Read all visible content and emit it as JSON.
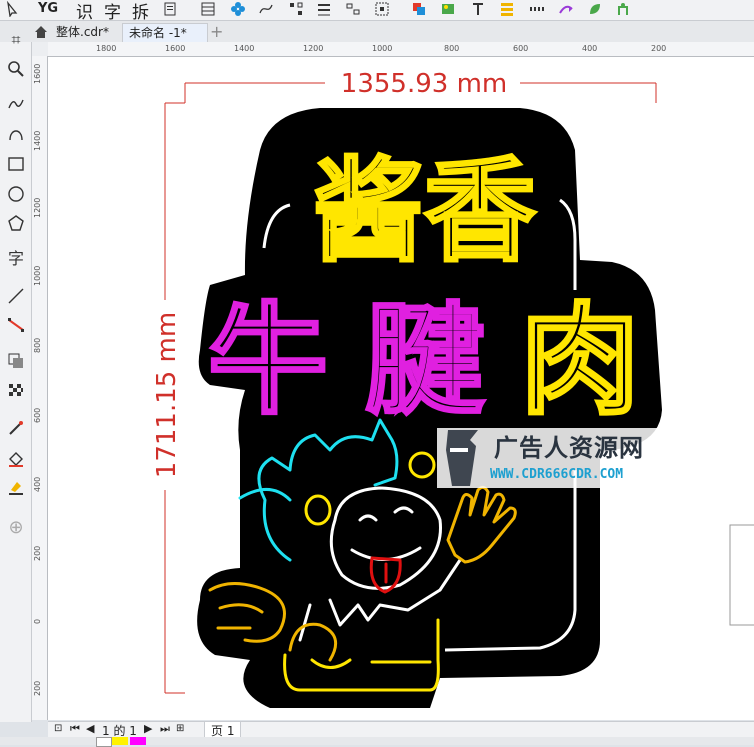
{
  "toolbar": {
    "glyph_yg": "YG",
    "glyph_shi": "识",
    "glyph_zi": "字",
    "glyph_chai": "拆"
  },
  "tabs": [
    {
      "label": "整体.cdr*",
      "active": false
    },
    {
      "label": "未命名 -1*",
      "active": true
    }
  ],
  "ruler_h": [
    "1800",
    "1600",
    "1400",
    "1200",
    "1000",
    "800",
    "600",
    "400",
    "200"
  ],
  "ruler_v": [
    "1600",
    "1400",
    "1200",
    "1000",
    "800",
    "600",
    "400",
    "200",
    "0",
    "200"
  ],
  "artwork": {
    "dim_width": "1355.93 mm",
    "dim_height": "1711.15 mm",
    "line1": "酱香",
    "line2_a": "牛",
    "line2_b": "腱",
    "line2_c": "肉",
    "colors": {
      "yellow": "#ffe600",
      "magenta": "#e020e0",
      "cyan": "#1ee0f0",
      "orange": "#f0b400",
      "red": "#e01010",
      "dim_red": "#d0302a"
    }
  },
  "watermark": {
    "title": "广告人资源网",
    "url": "WWW.CDR666CDR.COM"
  },
  "pagebar": {
    "page_count": "1 的 1",
    "page_label": "页 1"
  },
  "lefttool_glyph": "字"
}
